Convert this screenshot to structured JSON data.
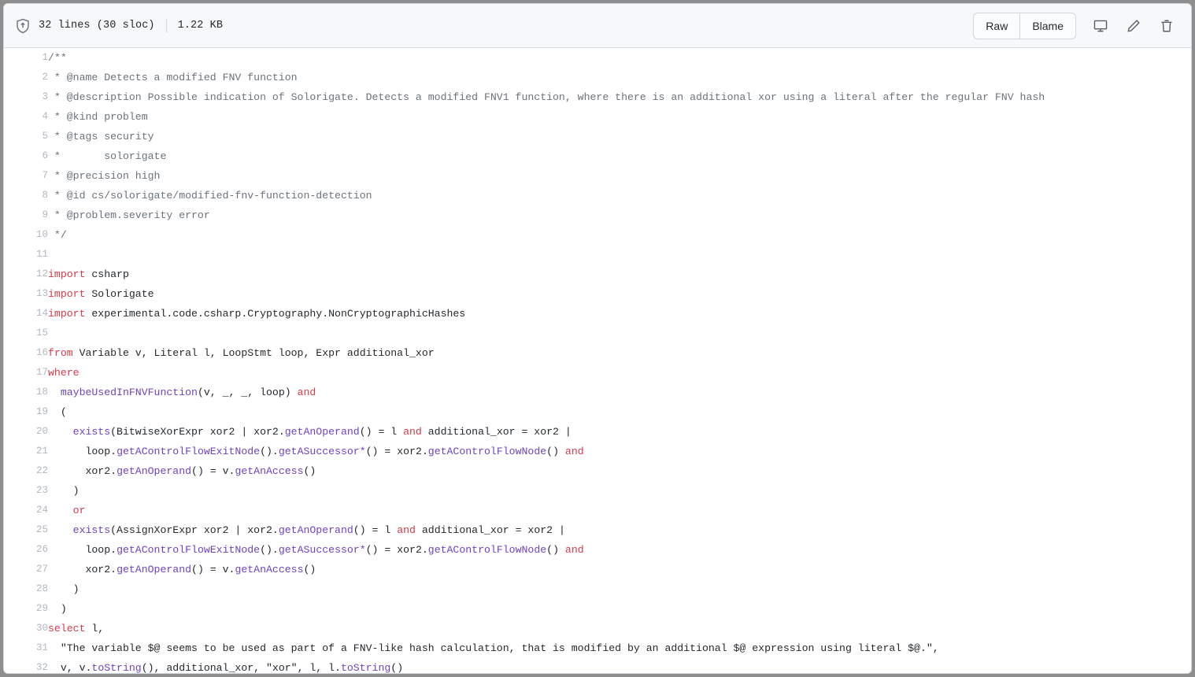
{
  "header": {
    "shield_icon": "shield-lock-icon",
    "lines_label": "32 lines (30 sloc)",
    "size_label": "1.22 KB",
    "raw_label": "Raw",
    "blame_label": "Blame",
    "desktop_icon": "open-in-desktop-icon",
    "edit_icon": "pencil-edit-icon",
    "delete_icon": "trash-delete-icon"
  },
  "colors": {
    "header_bg": "#f6f8fa",
    "border": "#d0d7de",
    "comment": "#6a737d",
    "keyword": "#d73a49",
    "function": "#6f42c1",
    "plain": "#24292e",
    "line_number": "#b1b8c0",
    "page_bg": "#8e8e8e"
  },
  "code": {
    "language": "ql",
    "total_lines": 32,
    "lines": [
      {
        "n": "1",
        "tokens": [
          {
            "t": "/**",
            "c": "c"
          }
        ]
      },
      {
        "n": "2",
        "tokens": [
          {
            "t": " * @name Detects a modified FNV function",
            "c": "c"
          }
        ]
      },
      {
        "n": "3",
        "tokens": [
          {
            "t": " * @description Possible indication of Solorigate. Detects a modified FNV1 function, where there is an additional xor using a literal after the regular FNV hash",
            "c": "c"
          }
        ]
      },
      {
        "n": "4",
        "tokens": [
          {
            "t": " * @kind problem",
            "c": "c"
          }
        ]
      },
      {
        "n": "5",
        "tokens": [
          {
            "t": " * @tags security",
            "c": "c"
          }
        ]
      },
      {
        "n": "6",
        "tokens": [
          {
            "t": " *       solorigate",
            "c": "c"
          }
        ]
      },
      {
        "n": "7",
        "tokens": [
          {
            "t": " * @precision high",
            "c": "c"
          }
        ]
      },
      {
        "n": "8",
        "tokens": [
          {
            "t": " * @id cs/solorigate/modified-fnv-function-detection",
            "c": "c"
          }
        ]
      },
      {
        "n": "9",
        "tokens": [
          {
            "t": " * @problem.severity error",
            "c": "c"
          }
        ]
      },
      {
        "n": "10",
        "tokens": [
          {
            "t": " */",
            "c": "c"
          }
        ]
      },
      {
        "n": "11",
        "tokens": [
          {
            "t": "",
            "c": "p"
          }
        ]
      },
      {
        "n": "12",
        "tokens": [
          {
            "t": "import",
            "c": "k"
          },
          {
            "t": " csharp",
            "c": "p"
          }
        ]
      },
      {
        "n": "13",
        "tokens": [
          {
            "t": "import",
            "c": "k"
          },
          {
            "t": " Solorigate",
            "c": "p"
          }
        ]
      },
      {
        "n": "14",
        "tokens": [
          {
            "t": "import",
            "c": "k"
          },
          {
            "t": " experimental.code.csharp.Cryptography.NonCryptographicHashes",
            "c": "p"
          }
        ]
      },
      {
        "n": "15",
        "tokens": [
          {
            "t": "",
            "c": "p"
          }
        ]
      },
      {
        "n": "16",
        "tokens": [
          {
            "t": "from",
            "c": "k"
          },
          {
            "t": " Variable v, Literal l, LoopStmt loop, Expr additional_xor",
            "c": "p"
          }
        ]
      },
      {
        "n": "17",
        "tokens": [
          {
            "t": "where",
            "c": "k"
          }
        ]
      },
      {
        "n": "18",
        "tokens": [
          {
            "t": "  ",
            "c": "p"
          },
          {
            "t": "maybeUsedInFNVFunction",
            "c": "fn"
          },
          {
            "t": "(v, _, _, loop) ",
            "c": "p"
          },
          {
            "t": "and",
            "c": "k"
          }
        ]
      },
      {
        "n": "19",
        "tokens": [
          {
            "t": "  (",
            "c": "p"
          }
        ]
      },
      {
        "n": "20",
        "tokens": [
          {
            "t": "    ",
            "c": "p"
          },
          {
            "t": "exists",
            "c": "fn"
          },
          {
            "t": "(BitwiseXorExpr xor2 | xor2.",
            "c": "p"
          },
          {
            "t": "getAnOperand",
            "c": "fn"
          },
          {
            "t": "() = l ",
            "c": "p"
          },
          {
            "t": "and",
            "c": "k"
          },
          {
            "t": " additional_xor = xor2 |",
            "c": "p"
          }
        ]
      },
      {
        "n": "21",
        "tokens": [
          {
            "t": "      loop.",
            "c": "p"
          },
          {
            "t": "getAControlFlowExitNode",
            "c": "fn"
          },
          {
            "t": "().",
            "c": "p"
          },
          {
            "t": "getASuccessor*",
            "c": "fn"
          },
          {
            "t": "() = xor2.",
            "c": "p"
          },
          {
            "t": "getAControlFlowNode",
            "c": "fn"
          },
          {
            "t": "() ",
            "c": "p"
          },
          {
            "t": "and",
            "c": "k"
          }
        ]
      },
      {
        "n": "22",
        "tokens": [
          {
            "t": "      xor2.",
            "c": "p"
          },
          {
            "t": "getAnOperand",
            "c": "fn"
          },
          {
            "t": "() = v.",
            "c": "p"
          },
          {
            "t": "getAnAccess",
            "c": "fn"
          },
          {
            "t": "()",
            "c": "p"
          }
        ]
      },
      {
        "n": "23",
        "tokens": [
          {
            "t": "    )",
            "c": "p"
          }
        ]
      },
      {
        "n": "24",
        "tokens": [
          {
            "t": "    ",
            "c": "p"
          },
          {
            "t": "or",
            "c": "k"
          }
        ]
      },
      {
        "n": "25",
        "tokens": [
          {
            "t": "    ",
            "c": "p"
          },
          {
            "t": "exists",
            "c": "fn"
          },
          {
            "t": "(AssignXorExpr xor2 | xor2.",
            "c": "p"
          },
          {
            "t": "getAnOperand",
            "c": "fn"
          },
          {
            "t": "() = l ",
            "c": "p"
          },
          {
            "t": "and",
            "c": "k"
          },
          {
            "t": " additional_xor = xor2 |",
            "c": "p"
          }
        ]
      },
      {
        "n": "26",
        "tokens": [
          {
            "t": "      loop.",
            "c": "p"
          },
          {
            "t": "getAControlFlowExitNode",
            "c": "fn"
          },
          {
            "t": "().",
            "c": "p"
          },
          {
            "t": "getASuccessor*",
            "c": "fn"
          },
          {
            "t": "() = xor2.",
            "c": "p"
          },
          {
            "t": "getAControlFlowNode",
            "c": "fn"
          },
          {
            "t": "() ",
            "c": "p"
          },
          {
            "t": "and",
            "c": "k"
          }
        ]
      },
      {
        "n": "27",
        "tokens": [
          {
            "t": "      xor2.",
            "c": "p"
          },
          {
            "t": "getAnOperand",
            "c": "fn"
          },
          {
            "t": "() = v.",
            "c": "p"
          },
          {
            "t": "getAnAccess",
            "c": "fn"
          },
          {
            "t": "()",
            "c": "p"
          }
        ]
      },
      {
        "n": "28",
        "tokens": [
          {
            "t": "    )",
            "c": "p"
          }
        ]
      },
      {
        "n": "29",
        "tokens": [
          {
            "t": "  )",
            "c": "p"
          }
        ]
      },
      {
        "n": "30",
        "tokens": [
          {
            "t": "select",
            "c": "k"
          },
          {
            "t": " l,",
            "c": "p"
          }
        ]
      },
      {
        "n": "31",
        "tokens": [
          {
            "t": "  \"The variable $@ seems to be used as part of a FNV-like hash calculation, that is modified by an additional $@ expression using literal $@.\",",
            "c": "p"
          }
        ]
      },
      {
        "n": "32",
        "tokens": [
          {
            "t": "  v, v.",
            "c": "p"
          },
          {
            "t": "toString",
            "c": "fn"
          },
          {
            "t": "(), additional_xor, \"xor\", l, l.",
            "c": "p"
          },
          {
            "t": "toString",
            "c": "fn"
          },
          {
            "t": "()",
            "c": "p"
          }
        ]
      }
    ]
  }
}
